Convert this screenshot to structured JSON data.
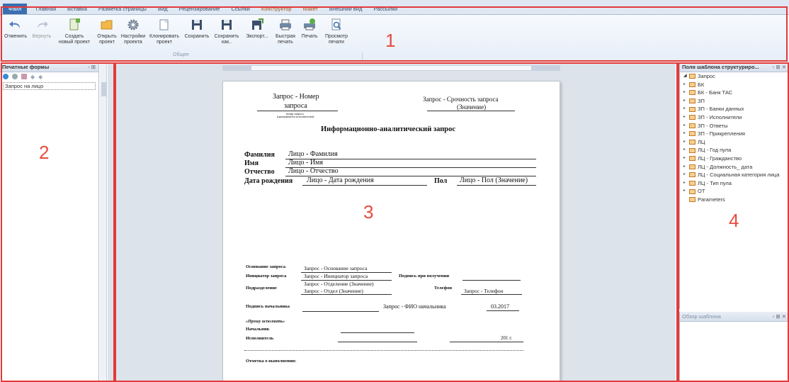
{
  "tabs": [
    "Файл",
    "Главная",
    "Вставка",
    "Разметка страницы",
    "Вид",
    "Рецензирование",
    "Ссылки",
    "Конструктор",
    "Макет",
    "Внешний вид",
    "Рассылки"
  ],
  "ribbon": {
    "undo": "Отменить",
    "redo": "Вернуть",
    "new_project": [
      "Создать",
      "новый проект"
    ],
    "open_project": [
      "Открыть",
      "проект"
    ],
    "settings": [
      "Настройки",
      "проекта"
    ],
    "clone": [
      "Клонировать",
      "проект"
    ],
    "save": "Сохранить",
    "save_as": [
      "Сохранить",
      "как.."
    ],
    "export": "Экспорт...",
    "quick_print": [
      "Быстрая",
      "печать"
    ],
    "print": "Печать",
    "preview": [
      "Просмотр",
      "печати"
    ],
    "group": "Общее"
  },
  "left_panel": {
    "title": "Печатные формы",
    "items": [
      "Запрос на лицо"
    ]
  },
  "right_panel": {
    "title": "Поля шаблона структуриро...",
    "bottom_title": "Обзор шаблона",
    "root": "Запрос",
    "items": [
      "БК",
      "БК - Банк ТАС",
      "ЗП",
      "ЗП - Банки данных",
      "ЗП - Исполнители",
      "ЗП - Ответы",
      "ЗП - Прикрепления",
      "ЛЦ",
      "ЛЦ - Год пула",
      "ЛЦ - Гражданство",
      "ЛЦ - Должность_ дата",
      "ЛЦ - Социальная категория лица",
      "ЛЦ - Тип пула",
      "ОТ"
    ],
    "params": "Parameters"
  },
  "doc": {
    "req_num1": "Запрос - Номер",
    "req_num2": "запроса",
    "tiny1": "номер запроса",
    "tiny2": "(присваивается исполнителем)",
    "urg1": "Запрос - Срочность запроса",
    "urg2": "(Значение)",
    "title": "Информационно-аналитический запрос",
    "lbl_fam": "Фамилия",
    "val_fam": "Лицо - Фамилия",
    "lbl_name": "Имя",
    "val_name": "Лицо - Имя",
    "lbl_otch": "Отчество",
    "val_otch": "Лицо - Отчество",
    "lbl_dob": "Дата рождения",
    "val_dob": "Лицо - Дата рождения",
    "lbl_sex": "Пол",
    "val_sex": "Лицо - Пол (Значение)",
    "lbl_basis": "Основание запроса",
    "val_basis": "Запрос - Основание запроса",
    "lbl_init": "Инициатор запроса",
    "val_init": "Запрос - Инициатор запроса",
    "lbl_sign_get": "Подпись при получении",
    "lbl_dep": "Подразделение",
    "val_dep1": "Запрос - Отделение (Значение)",
    "val_dep2": "Запрос - Отдел (Значение)",
    "lbl_phone": "Телефон",
    "val_phone": "Запрос - Телефон",
    "lbl_boss_sign": "Подпись начальника",
    "val_boss": "Запрос - ФИО начальника",
    "date": "03.2017",
    "lbl_ask": "«Прошу исполнить»",
    "lbl_chief": "Начальник",
    "lbl_exec": "Исполнитель",
    "year": "201  г.",
    "lbl_done": "Отметка о выполнении:"
  },
  "annotations": [
    "1",
    "2",
    "3",
    "4"
  ]
}
